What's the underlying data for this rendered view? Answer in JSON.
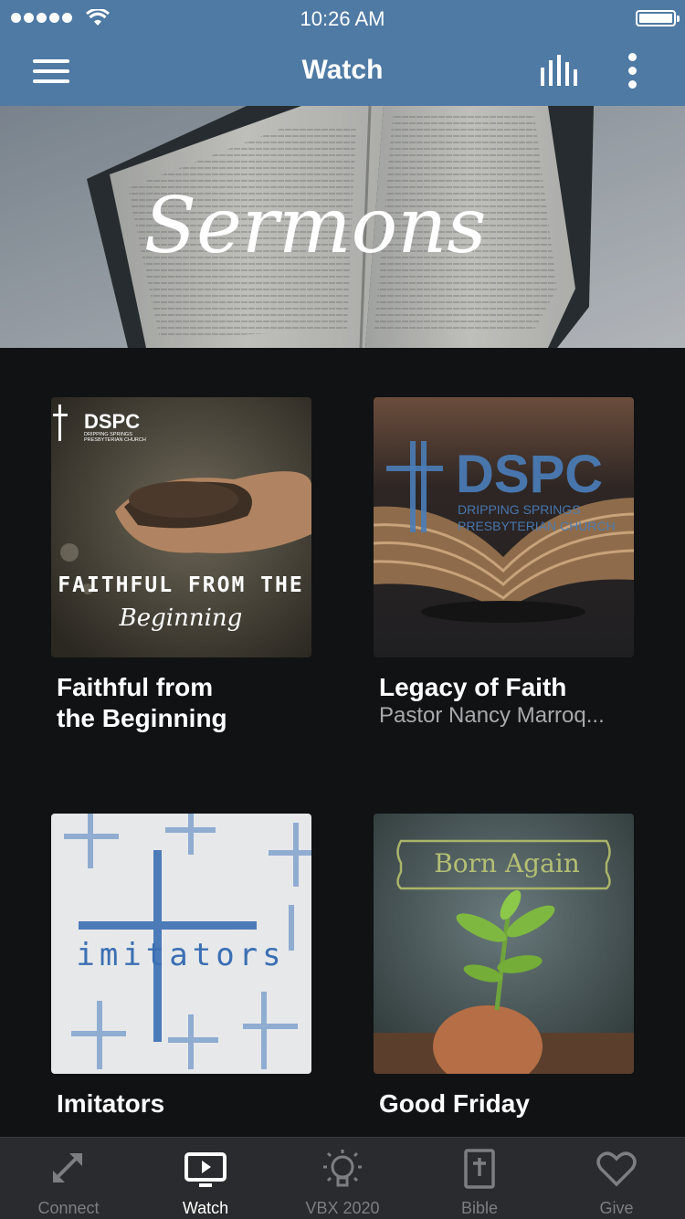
{
  "status_bar": {
    "time": "10:26 AM"
  },
  "header": {
    "title": "Watch"
  },
  "banner": {
    "text": "Sermons"
  },
  "sermons": [
    {
      "title_line1": "Faithful from",
      "title_line2": "the Beginning",
      "subtitle": "",
      "art_text_top": "FAITHFUL FROM THE",
      "art_text_script": "Beginning",
      "logo_text": "DSPC",
      "logo_subtext_1": "DRIPPING SPRINGS",
      "logo_subtext_2": "PRESBYTERIAN CHURCH"
    },
    {
      "title_line1": "Legacy of Faith",
      "title_line2": "",
      "subtitle": "Pastor Nancy Marroq...",
      "logo_text": "DSPC",
      "logo_subtext_1": "DRIPPING SPRINGS",
      "logo_subtext_2": "PRESBYTERIAN CHURCH"
    },
    {
      "title_line1": "Imitators",
      "title_line2": "",
      "subtitle": "",
      "art_text": "imitators"
    },
    {
      "title_line1": "Good Friday",
      "title_line2": "",
      "subtitle": "",
      "art_text": "Born Again"
    }
  ],
  "tabs": [
    {
      "label": "Connect",
      "icon": "connect-arrows-icon",
      "active": false
    },
    {
      "label": "Watch",
      "icon": "tv-play-icon",
      "active": true
    },
    {
      "label": "VBX 2020",
      "icon": "lightbulb-icon",
      "active": false
    },
    {
      "label": "Bible",
      "icon": "bible-icon",
      "active": false
    },
    {
      "label": "Give",
      "icon": "heart-icon",
      "active": false
    }
  ],
  "colors": {
    "header": "#4f7aa4",
    "background": "#111214",
    "tabbar": "#2a2b2e"
  }
}
